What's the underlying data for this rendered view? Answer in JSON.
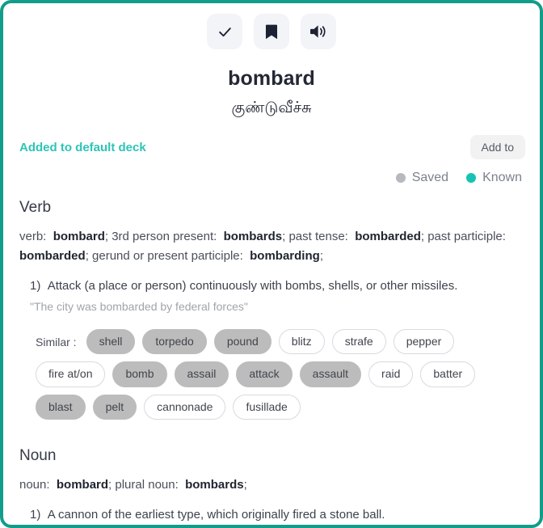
{
  "toolbar": {
    "buttons": [
      {
        "name": "mark-known-button",
        "icon": "check-icon"
      },
      {
        "name": "bookmark-button",
        "icon": "bookmark-icon"
      },
      {
        "name": "pronounce-button",
        "icon": "speaker-icon"
      }
    ]
  },
  "word": {
    "headword": "bombard",
    "translation": "குண்டுவீச்சு"
  },
  "deck": {
    "status_text": "Added to default deck",
    "add_button_label": "Add to"
  },
  "legend": {
    "saved_label": "Saved",
    "known_label": "Known",
    "saved_color": "#b6b9bd",
    "known_color": "#17c3b2"
  },
  "sections": [
    {
      "heading": "Verb",
      "forms_html": "verb:&nbsp; <b>bombard</b>; 3rd person present:&nbsp; <b>bombards</b>; past tense:&nbsp; <b>bombarded</b>; past participle:&nbsp; <b>bombarded</b>; gerund or present participle:&nbsp; <b>bombarding</b>;",
      "senses": [
        {
          "number": "1)",
          "text": "Attack (a place or person) continuously with bombs, shells, or other missiles.",
          "quote": "\"The city was bombarded by federal forces\""
        }
      ]
    },
    {
      "heading": "Noun",
      "forms_html": "noun:&nbsp; <b>bombard</b>; plural noun:&nbsp; <b>bombards</b>;",
      "senses": [
        {
          "number": "1)",
          "text": "A cannon of the earliest type, which originally fired a stone ball.",
          "quote": ""
        }
      ]
    }
  ],
  "similar": {
    "label": "Similar :",
    "rows": [
      [
        {
          "text": "shell",
          "style": "filled"
        },
        {
          "text": "torpedo",
          "style": "filled"
        },
        {
          "text": "pound",
          "style": "filled"
        },
        {
          "text": "blitz",
          "style": "outlined"
        },
        {
          "text": "strafe",
          "style": "outlined"
        },
        {
          "text": "pepper",
          "style": "outlined"
        }
      ],
      [
        {
          "text": "fire at/on",
          "style": "outlined"
        },
        {
          "text": "bomb",
          "style": "filled"
        },
        {
          "text": "assail",
          "style": "filled"
        },
        {
          "text": "attack",
          "style": "filled"
        },
        {
          "text": "assault",
          "style": "filled"
        },
        {
          "text": "raid",
          "style": "outlined"
        },
        {
          "text": "batter",
          "style": "outlined"
        }
      ],
      [
        {
          "text": "blast",
          "style": "filled"
        },
        {
          "text": "pelt",
          "style": "filled"
        },
        {
          "text": "cannonade",
          "style": "outlined"
        },
        {
          "text": "fusillade",
          "style": "outlined"
        }
      ]
    ]
  },
  "theme": {
    "border_color": "#129c8b",
    "accent_teal": "#2ec4b6",
    "chip_filled": "#bcbcbc"
  }
}
